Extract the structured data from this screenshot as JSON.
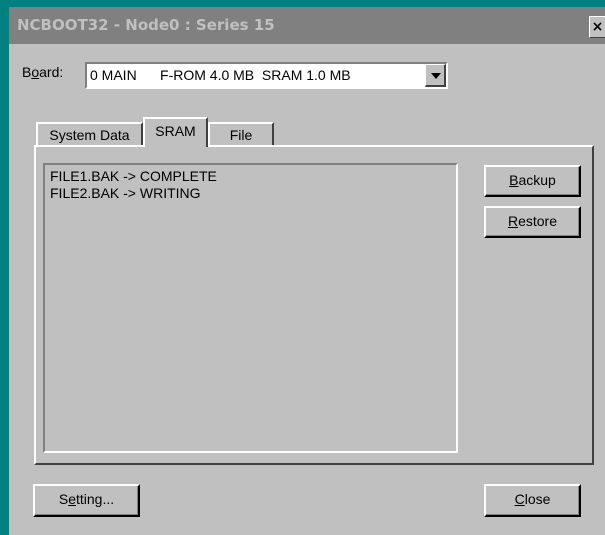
{
  "window": {
    "title": "NCBOOT32 - Node0 : Series 15",
    "close_glyph": "×"
  },
  "board": {
    "label_mnemonic": "o",
    "label_pre": "B",
    "label_post": "ard:",
    "selected_value": "0 MAIN      F-ROM 4.0 MB  SRAM 1.0 MB"
  },
  "tabs": [
    {
      "label": "System Data",
      "active": false
    },
    {
      "label": "SRAM",
      "active": true
    },
    {
      "label": "File",
      "active": false
    }
  ],
  "status_lines": [
    "FILE1.BAK -> COMPLETE",
    "FILE2.BAK -> WRITING"
  ],
  "buttons": {
    "backup": {
      "mn": "B",
      "rest": "ackup"
    },
    "restore": {
      "mn": "R",
      "rest": "estore"
    },
    "setting": {
      "pre": "S",
      "mn": "e",
      "rest": "tting..."
    },
    "close": {
      "mn": "C",
      "rest": "lose"
    }
  },
  "colors": {
    "desktop": "#008080",
    "face": "#c0c0c0",
    "titlebar_inactive": "#808080"
  }
}
